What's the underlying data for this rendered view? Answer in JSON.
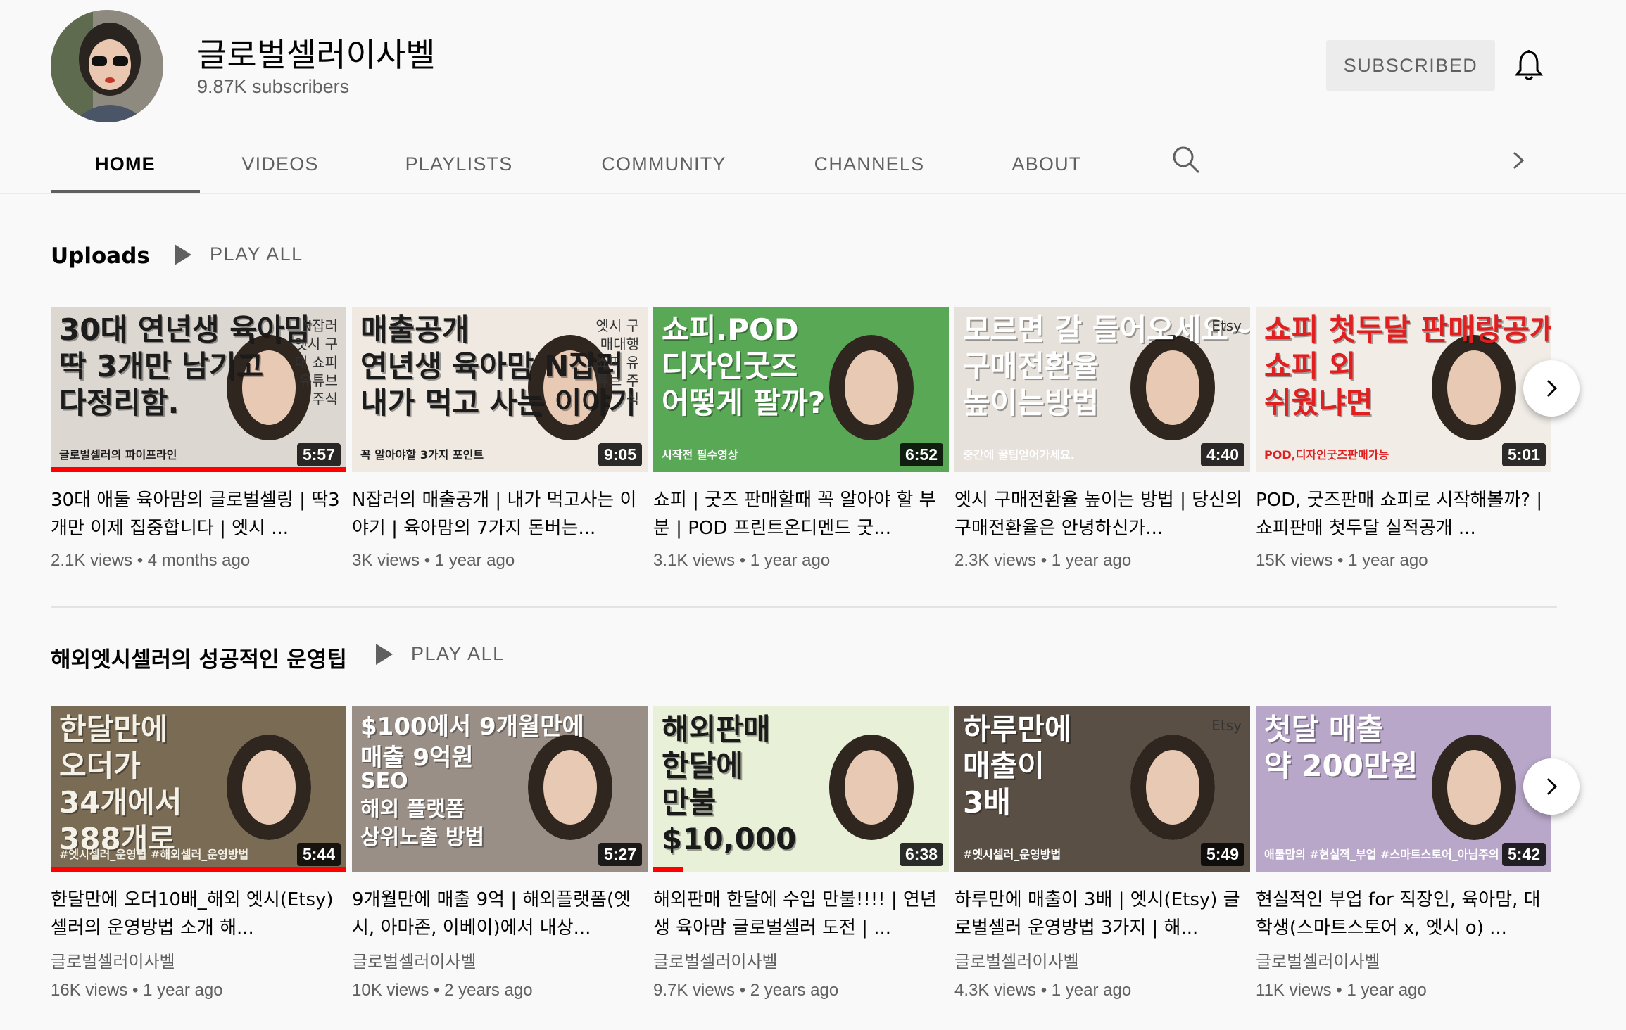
{
  "channel": {
    "name": "글로벌셀러이사벨",
    "subscribers": "9.87K subscribers",
    "subscribe_label": "SUBSCRIBED"
  },
  "tabs": [
    "HOME",
    "VIDEOS",
    "PLAYLISTS",
    "COMMUNITY",
    "CHANNELS",
    "ABOUT"
  ],
  "icons": {
    "bell": "bell-icon",
    "search": "search-icon",
    "chevron": "chevron-right-icon",
    "play": "play-icon"
  },
  "colors": {
    "accent_red": "#ff0000",
    "text_primary": "#030303",
    "text_secondary": "#606060"
  },
  "uploads": {
    "title": "Uploads",
    "play_all": "PLAY ALL",
    "videos": [
      {
        "thumb_text": [
          "30대 연년생 육아맘",
          "딱 3개만 남기고",
          "다정리함."
        ],
        "thumb_side": "N잡러 엣시 구대 쇼피 유튜브 주식",
        "thumb_small": "글로벌셀러의 파이프라인",
        "duration": "5:57",
        "title": "30대 애둘 육아맘의 글로벌셀링 | 딱3개만 이제 집중합니다 | 엣시 ...",
        "meta": "2.1K views • 4 months ago",
        "progress": 1.0
      },
      {
        "thumb_text": [
          "매출공개",
          "연년생 육아맘 N잡러",
          "내가 먹고 사는 이야기"
        ],
        "thumb_side": "엣시 구매대행 쇼피 유튜브 주식",
        "thumb_small": "꼭 알아야할 3가지 포인트",
        "duration": "9:05",
        "title": "N잡러의 매출공개 | 내가 먹고사는 이야기 | 육아맘의 7가지 돈버는...",
        "meta": "3K views • 1 year ago",
        "progress": 0
      },
      {
        "thumb_text": [
          "쇼피.POD",
          "디자인굿즈",
          "어떻게 팔까?"
        ],
        "thumb_side": "",
        "thumb_small": "시작전 필수영상",
        "duration": "6:52",
        "title": "쇼피 | 굿즈 판매할때 꼭 알아야 할 부분 | POD 프린트온디멘드 굿...",
        "meta": "3.1K views • 1 year ago",
        "progress": 0
      },
      {
        "thumb_text": [
          "모르면 갈 들어오세요~",
          "구매전환율",
          "높이는방법"
        ],
        "thumb_side": "Etsy",
        "thumb_small": "중간에 꿀팁얻어가세요.",
        "duration": "4:40",
        "title": "엣시 구매전환율 높이는 방법 | 당신의 구매전환율은 안녕하신가...",
        "meta": "2.3K views • 1 year ago",
        "progress": 0
      },
      {
        "thumb_text": [
          "쇼피 첫두달 판매량공개",
          "쇼피 외",
          "쉬웠냐면"
        ],
        "thumb_side": "",
        "thumb_small": "POD,디자인굿즈판매가능",
        "duration": "5:01",
        "title": "POD, 굿즈판매 쇼피로 시작해볼까? | 쇼피판매 첫두달 실적공개 ...",
        "meta": "15K views • 1 year ago",
        "progress": 0
      }
    ]
  },
  "playlist": {
    "title": "해외엣시셀러의 성공적인 운영팁",
    "play_all": "PLAY ALL",
    "videos": [
      {
        "thumb_text": [
          "한달만에",
          "오더가",
          "34개에서",
          "388개로"
        ],
        "thumb_side": "",
        "thumb_small": "#엣시셀러_운영팁 #해외셀러_운영방법",
        "duration": "5:44",
        "title": "한달만에 오더10배_해외 엣시(Etsy) 셀러의 운영방법 소개 해...",
        "channel": "글로벌셀러이사벨",
        "meta": "16K views • 1 year ago",
        "progress": 1.0
      },
      {
        "thumb_text": [
          "$100에서 9개월만에",
          "매출 9억원",
          "SEO",
          "해외 플랫폼",
          "상위노출 방법"
        ],
        "thumb_side": "",
        "thumb_small": "",
        "duration": "5:27",
        "title": "9개월만에 매출 9억 | 해외플랫폼(엣시, 아마존, 이베이)에서 내상...",
        "channel": "글로벌셀러이사벨",
        "meta": "10K views • 2 years ago",
        "progress": 0
      },
      {
        "thumb_text": [
          "해외판매",
          "한달에",
          "만불",
          "$10,000"
        ],
        "thumb_side": "",
        "thumb_small": "",
        "duration": "6:38",
        "title": "해외판매 한달에 수입 만불!!!! | 연년생 육아맘 글로벌셀러 도전 | ...",
        "channel": "글로벌셀러이사벨",
        "meta": "9.7K views • 2 years ago",
        "progress": 0.1
      },
      {
        "thumb_text": [
          "하루만에",
          "매출이",
          "3배"
        ],
        "thumb_side": "Etsy",
        "thumb_small": "#엣시셀러_운영방법",
        "duration": "5:49",
        "title": "하루만에 매출이 3배 | 엣시(Etsy) 글로벌셀러 운영방법 3가지 | 해...",
        "channel": "글로벌셀러이사벨",
        "meta": "4.3K views • 1 year ago",
        "progress": 0
      },
      {
        "thumb_text": [
          "첫달 매출",
          "약 200만원"
        ],
        "thumb_side": "",
        "thumb_small": "애둘맘의 #현실적_부업 #스마트스토어_아님주의",
        "duration": "5:42",
        "title": "현실적인 부업 for 직장인, 육아맘, 대학생(스마트스토어 x, 엣시 o) ...",
        "channel": "글로벌셀러이사벨",
        "meta": "11K views • 1 year ago",
        "progress": 0
      }
    ]
  }
}
